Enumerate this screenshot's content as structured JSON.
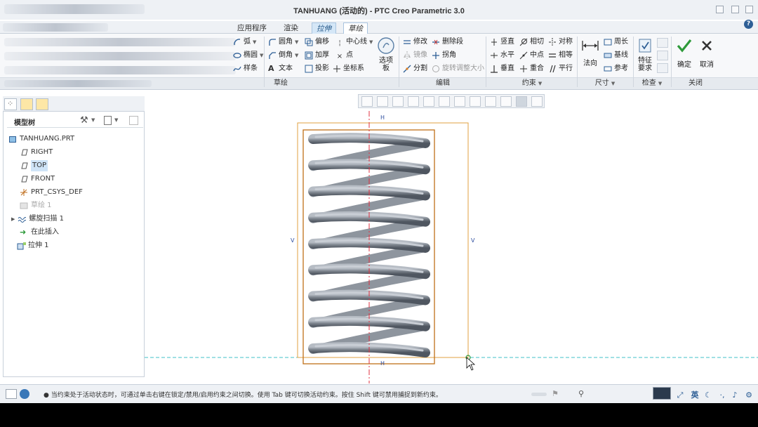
{
  "window": {
    "title": "TANHUANG (活动的) - PTC Creo Parametric 3.0"
  },
  "tabs": [
    {
      "label": "应用程序"
    },
    {
      "label": "渲染"
    },
    {
      "label": "拉伸"
    },
    {
      "label": "草绘"
    }
  ],
  "ribbon": {
    "left": {
      "arc": "弧",
      "ellipse": "椭圆",
      "spline": "样条"
    },
    "sketch": {
      "fillet": "圆角",
      "chamfer": "倒角",
      "text": "文本",
      "offset": "偏移",
      "thicken": "加厚",
      "project": "投影",
      "centerline": "中心线",
      "point": "点",
      "coord_sys": "坐标系",
      "palette": "选项板",
      "group_label": "草绘"
    },
    "edit": {
      "modify": "修改",
      "mirror": "镜像",
      "divide": "分割",
      "delete_segment": "删除段",
      "corner": "拐角",
      "rotate_resize": "旋转调整大小",
      "group_label": "编辑"
    },
    "constrain": {
      "vertical": "竖直",
      "horizontal": "水平",
      "perpendicular": "垂直",
      "tangent": "相切",
      "midpoint": "中点",
      "coincident": "重合",
      "symmetric": "对称",
      "equal": "相等",
      "parallel": "平行",
      "group_label": "约束"
    },
    "dimension": {
      "normal": "法向",
      "perimeter": "周长",
      "baseline": "基线",
      "reference": "参考",
      "group_label": "尺寸"
    },
    "inspect": {
      "feature_req": "特征要求",
      "group_label": "检查"
    },
    "close": {
      "ok": "确定",
      "cancel": "取消",
      "group_label": "关闭"
    }
  },
  "model_tree": {
    "title": "模型树",
    "items": [
      {
        "label": "TANHUANG.PRT"
      },
      {
        "label": "RIGHT"
      },
      {
        "label": "TOP"
      },
      {
        "label": "FRONT"
      },
      {
        "label": "PRT_CSYS_DEF"
      },
      {
        "label": "草绘 1"
      },
      {
        "label": "螺旋扫描 1"
      },
      {
        "label": "在此插入"
      },
      {
        "label": "拉伸 1"
      }
    ]
  },
  "canvas": {
    "dim_h": "H",
    "dim_v": "V"
  },
  "status": {
    "message": "● 当约束处于活动状态时，可通过单击右键在锁定/禁用/启用约束之间切换。使用 Tab 键可切换活动约束。按住 Shift 键可禁用捕捉到新约束。",
    "lang": "英"
  },
  "colors": {
    "accent": "#2e5f96",
    "sketch_box": "#e0a040",
    "centerline_red": "#e03040",
    "dashed_cyan": "#40c0c8",
    "spring": "#7a818a"
  }
}
